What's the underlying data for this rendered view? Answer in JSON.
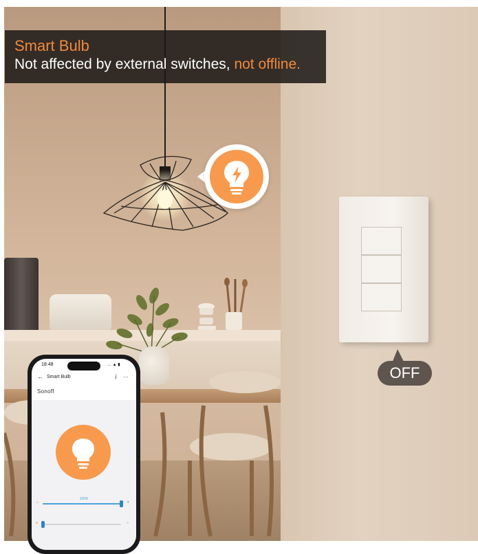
{
  "caption": {
    "title": "Smart Bulb",
    "line_prefix": "Not affected by external switches, ",
    "line_highlight": "not offline."
  },
  "switch_status": "OFF",
  "phone": {
    "time": "18:48",
    "status_icons": "… ▲ ▮",
    "back_glyph": "←",
    "screen_title": "Smart Bulb",
    "info_glyph": "i",
    "more_glyph": "…",
    "brand": "Sonoff",
    "brightness_label": "100%",
    "brightness": 1.0,
    "color_temperature": 0.0
  },
  "icons": {
    "badge": "bulb-lightning-icon",
    "phone_bulb": "bulb-icon"
  },
  "colors": {
    "accent_orange": "#f08a3c",
    "bulb_orange": "#f79a4e",
    "slider_blue": "#4aa3df",
    "caption_bg": "#1c1816",
    "off_badge_bg": "#5e554e"
  }
}
